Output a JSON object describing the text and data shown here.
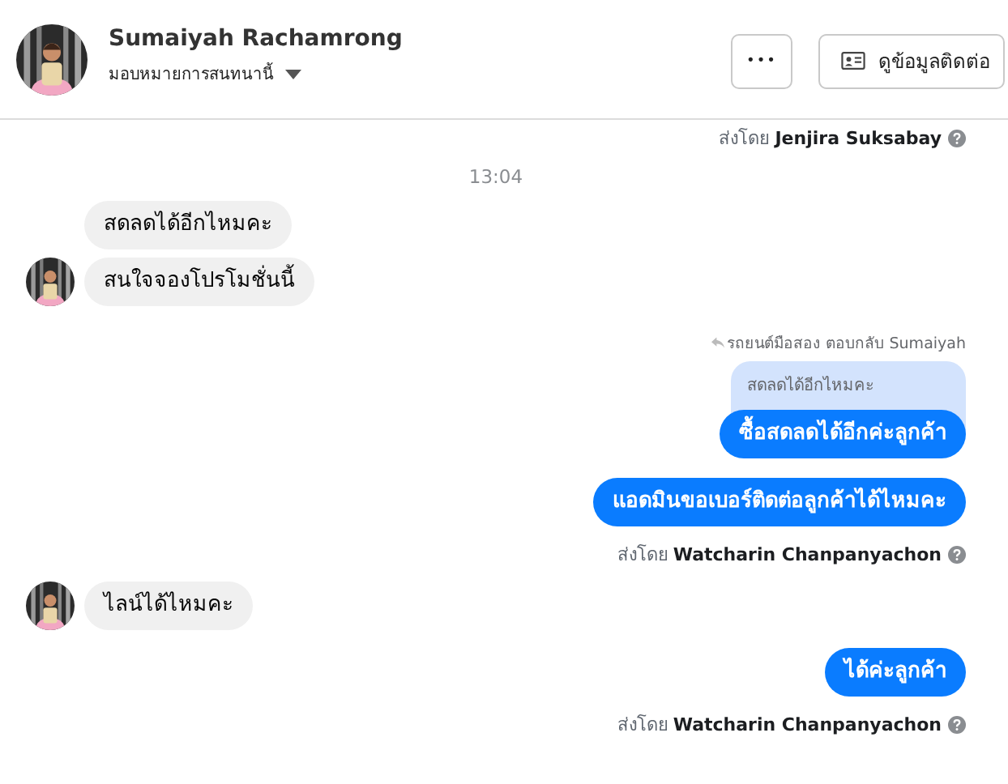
{
  "header": {
    "name": "Sumaiyah Rachamrong",
    "assign_label": "มอบหมายการสนทนานี้",
    "more_button": "•••",
    "contact_button": "ดูข้อมูลติดต่อ"
  },
  "messages": [
    {
      "kind": "sender",
      "text": "ส่งโดย **Jenjira Suksabay**"
    },
    {
      "kind": "time",
      "text": "13:04"
    },
    {
      "kind": "incoming",
      "text": "สดลดได้อีกไหมคะ",
      "avatar": false
    },
    {
      "kind": "incoming",
      "text": "สนใจจองโปรโมชั่นนี้",
      "avatar": true
    },
    {
      "kind": "reply",
      "label": "รถยนต์มือสอง ตอบกลับ Sumaiyah",
      "quote": "สดลดได้อีกไหมคะ",
      "text": "ซื้อสดลดได้อีกค่ะลูกค้า"
    },
    {
      "kind": "outgoing",
      "text": "แอดมินขอเบอร์ติดต่อลูกค้าได้ไหมคะ"
    },
    {
      "kind": "sender",
      "text": "ส่งโดย **Watcharin Chanpanyachon**"
    },
    {
      "kind": "incoming",
      "text": "ไลน์ได้ไหมคะ",
      "avatar": true
    },
    {
      "kind": "outgoing",
      "text": "ได้ค่ะลูกค้า"
    },
    {
      "kind": "sender",
      "text": "ส่งโดย **Watcharin Chanpanyachon**"
    }
  ]
}
